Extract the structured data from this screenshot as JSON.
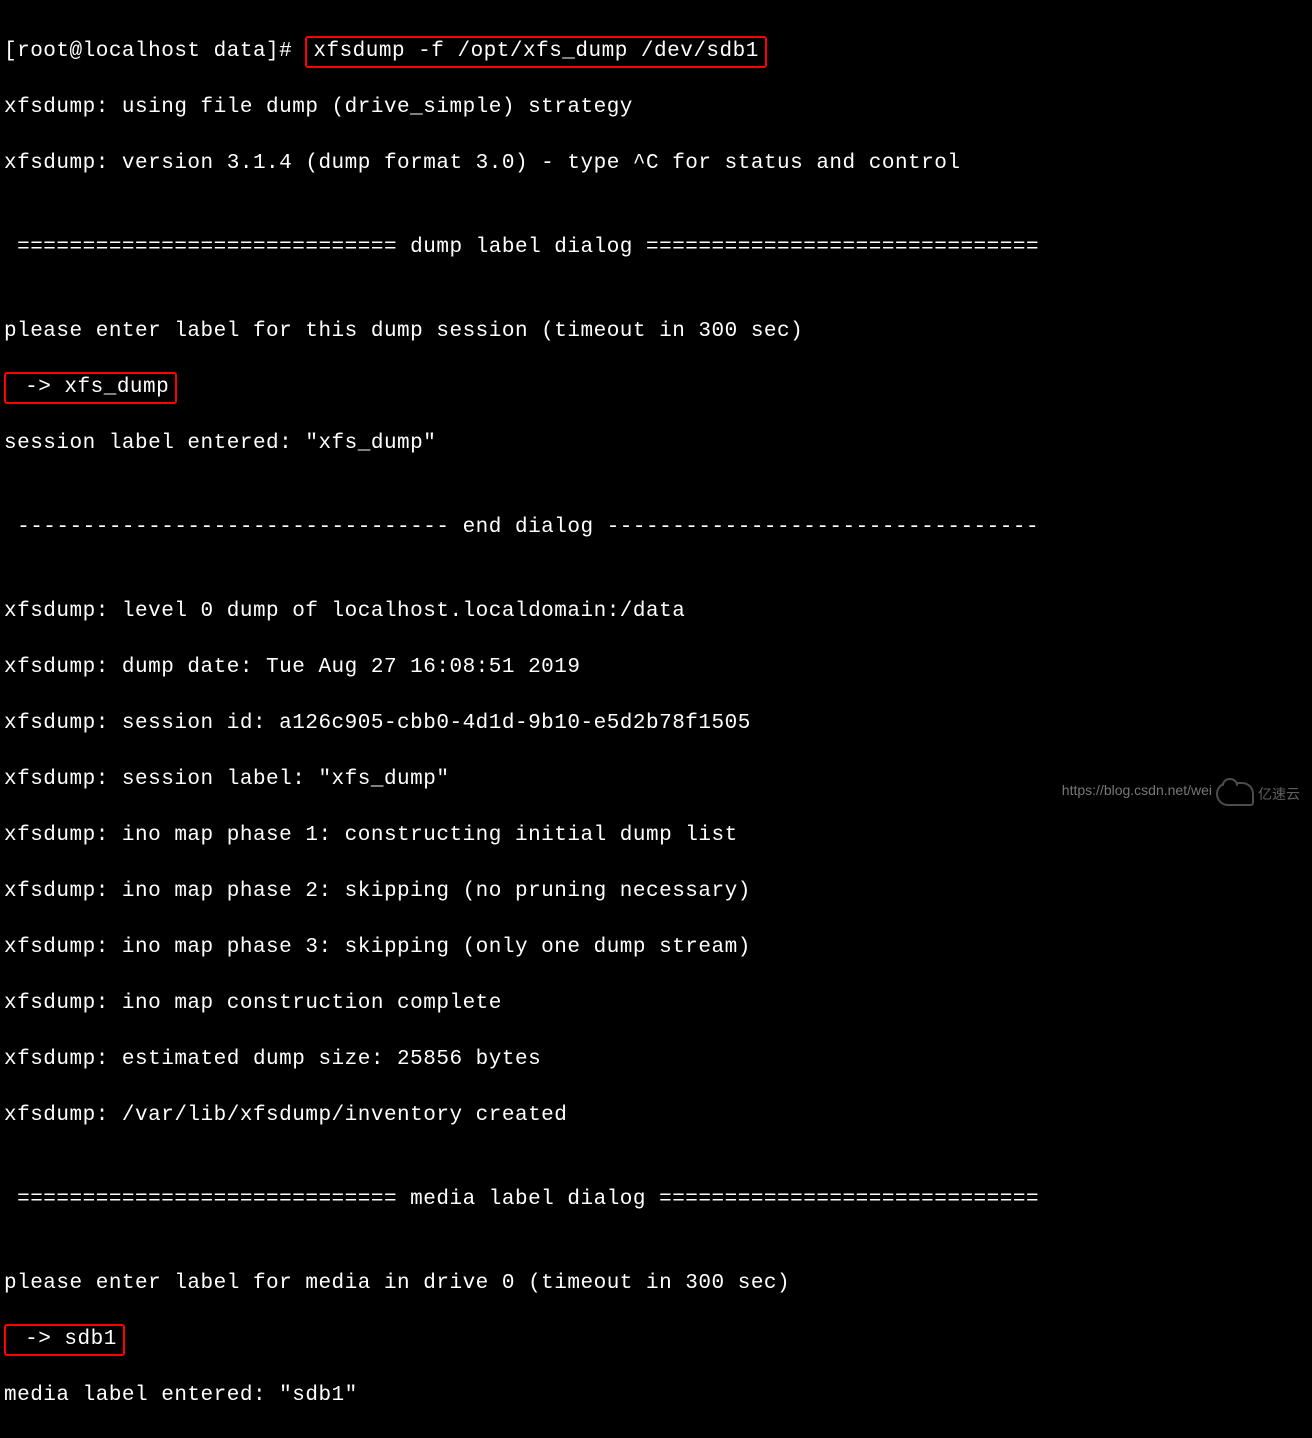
{
  "prompt": "[root@localhost data]# ",
  "command": "xfsdump -f /opt/xfs_dump /dev/sdb1",
  "lines": {
    "l1": "xfsdump: using file dump (drive_simple) strategy",
    "l2": "xfsdump: version 3.1.4 (dump format 3.0) - type ^C for status and control",
    "l3": "",
    "l4": " ============================= dump label dialog ==============================",
    "l5": "",
    "l6": "please enter label for this dump session (timeout in 300 sec)",
    "l7_input": " -> xfs_dump",
    "l8": "session label entered: \"xfs_dump\"",
    "l9": "",
    "l10": " --------------------------------- end dialog ---------------------------------",
    "l11": "",
    "l12": "xfsdump: level 0 dump of localhost.localdomain:/data",
    "l13": "xfsdump: dump date: Tue Aug 27 16:08:51 2019",
    "l14": "xfsdump: session id: a126c905-cbb0-4d1d-9b10-e5d2b78f1505",
    "l15": "xfsdump: session label: \"xfs_dump\"",
    "l16": "xfsdump: ino map phase 1: constructing initial dump list",
    "l17": "xfsdump: ino map phase 2: skipping (no pruning necessary)",
    "l18": "xfsdump: ino map phase 3: skipping (only one dump stream)",
    "l19": "xfsdump: ino map construction complete",
    "l20": "xfsdump: estimated dump size: 25856 bytes",
    "l21": "xfsdump: /var/lib/xfsdump/inventory created",
    "l22": "",
    "l23": " ============================= media label dialog =============================",
    "l24": "",
    "l25": "please enter label for media in drive 0 (timeout in 300 sec)",
    "l26_input": " -> sdb1",
    "l27": "media label entered: \"sdb1\""
  },
  "watermark": "https://blog.csdn.net/wei",
  "brand_text": "亿速云"
}
